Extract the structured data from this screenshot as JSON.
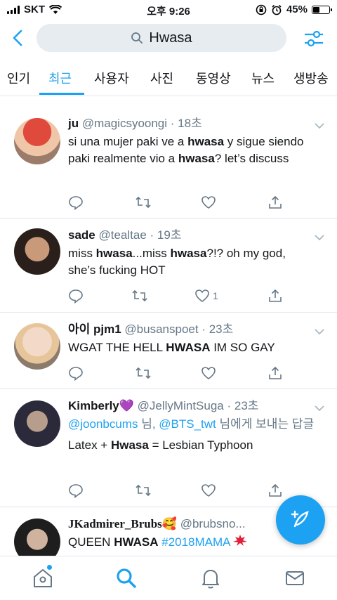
{
  "status": {
    "carrier": "SKT",
    "time": "오후 9:26",
    "battery": "45%",
    "battery_level": 0.45
  },
  "search": {
    "query": "Hwasa"
  },
  "tabs": [
    "인기",
    "최근",
    "사용자",
    "사진",
    "동영상",
    "뉴스",
    "생방송"
  ],
  "active_tab": "최근",
  "tweets": [
    {
      "name": "ju",
      "handle": "@magicsyoongi",
      "time": "18초",
      "text": [
        [
          "si una mujer paki ve a ",
          false
        ],
        [
          "hwasa",
          true
        ],
        [
          " y sigue siendo paki realmente vio a ",
          false
        ],
        [
          "hwasa",
          true
        ],
        [
          "? let’s discuss",
          false
        ]
      ]
    },
    {
      "name": "sade",
      "handle": "@tealtae",
      "time": "19초",
      "likes": "1",
      "text": [
        [
          "miss ",
          false
        ],
        [
          "hwasa",
          true
        ],
        [
          "...miss ",
          false
        ],
        [
          "hwasa",
          true
        ],
        [
          "?!? oh my god, she’s fucking HOT",
          false
        ]
      ]
    },
    {
      "name": "아이 pjm1",
      "handle": "@busanspoet",
      "time": "23초",
      "text": [
        [
          "WGAT THE HELL ",
          false
        ],
        [
          "HWASA",
          true
        ],
        [
          " IM SO GAY",
          false
        ]
      ]
    },
    {
      "name": "Kimberly",
      "name_emoji": "💜",
      "handle": "@JellyMintSuga",
      "time": "23초",
      "reply_to": {
        "user1": "@joonbcums",
        "user2": "@BTS_twt",
        "suffix1": " 님, ",
        "suffix2": " 님",
        "tail": "에게 보내는 답글"
      },
      "text": [
        [
          "Latex + ",
          false
        ],
        [
          "Hwasa",
          true
        ],
        [
          " = Lesbian Typhoon",
          false
        ]
      ]
    },
    {
      "name": "JKadmirer_Brubs",
      "name_emoji": "🥰",
      "handle": "@brubsno...",
      "time": "",
      "text": [
        [
          "QUEEN ",
          false
        ],
        [
          "HWASA",
          true
        ],
        [
          " ",
          false
        ]
      ],
      "hashtag": "#2018MAMA",
      "brand": "MAMA"
    }
  ],
  "colors": {
    "accent": "#1da1f2",
    "secondary": "#657786",
    "text": "#14171a",
    "divider": "#e1e8ed",
    "search_bg": "#e6ecf0",
    "brand_red": "#e0203a"
  }
}
